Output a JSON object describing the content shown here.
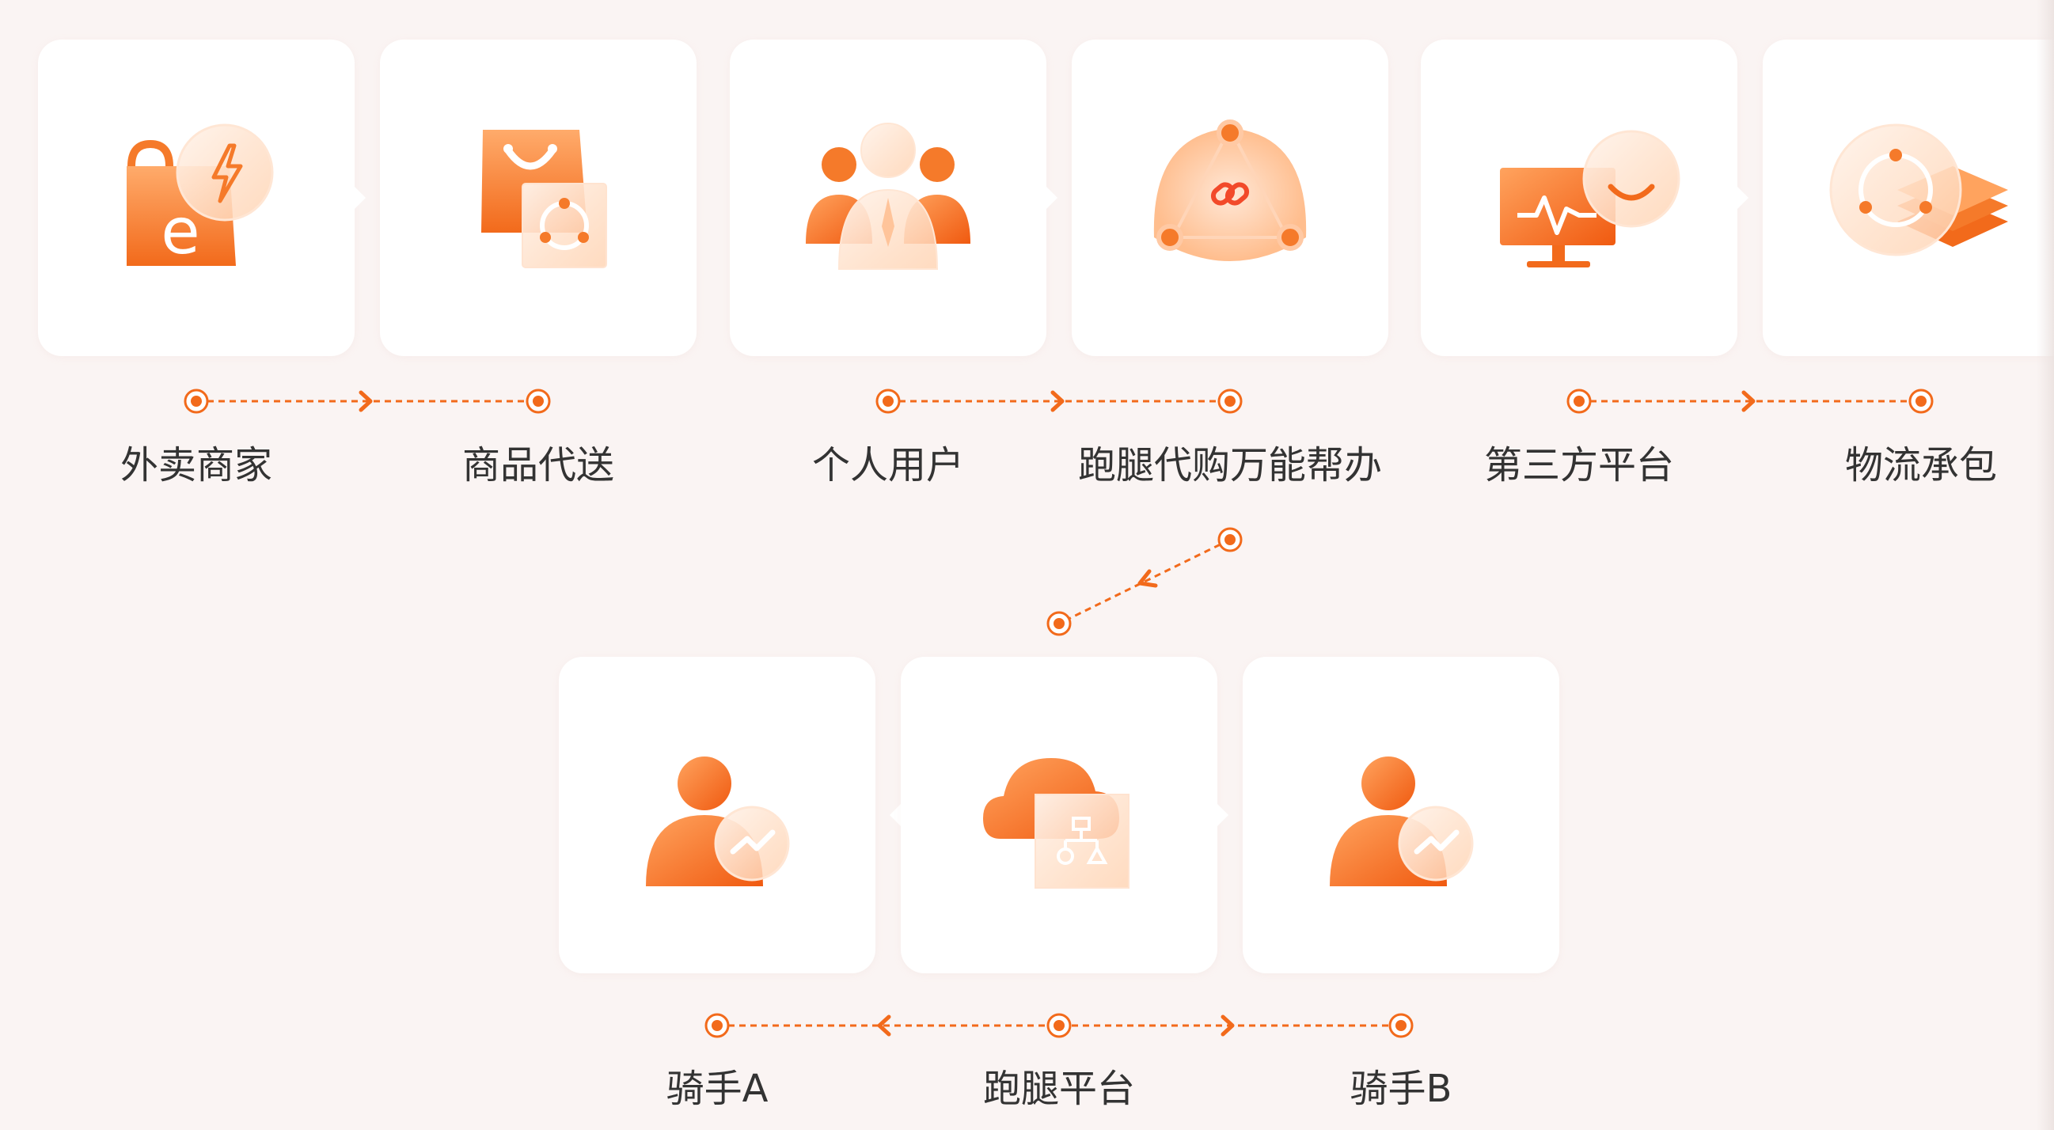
{
  "top_row": [
    {
      "label": "外卖商家",
      "icon": "shopping-bag-lightning-icon"
    },
    {
      "label": "商品代送",
      "icon": "shopping-bag-delivery-icon"
    },
    {
      "label": "个人用户",
      "icon": "user-group-icon"
    },
    {
      "label": "跑腿代购万能帮办",
      "icon": "link-network-icon"
    },
    {
      "label": "第三方平台",
      "icon": "monitor-smile-icon"
    },
    {
      "label": "物流承包",
      "icon": "layers-circle-icon"
    }
  ],
  "bottom_row": [
    {
      "label": "骑手A",
      "icon": "rider-trend-icon"
    },
    {
      "label": "跑腿平台",
      "icon": "cloud-network-icon"
    },
    {
      "label": "骑手B",
      "icon": "rider-trend-icon"
    }
  ],
  "colors": {
    "accent": "#f26a1b",
    "accent_light": "#ffb27a",
    "card": "#ffffff",
    "background": "#faf4f3",
    "text": "#333333"
  }
}
